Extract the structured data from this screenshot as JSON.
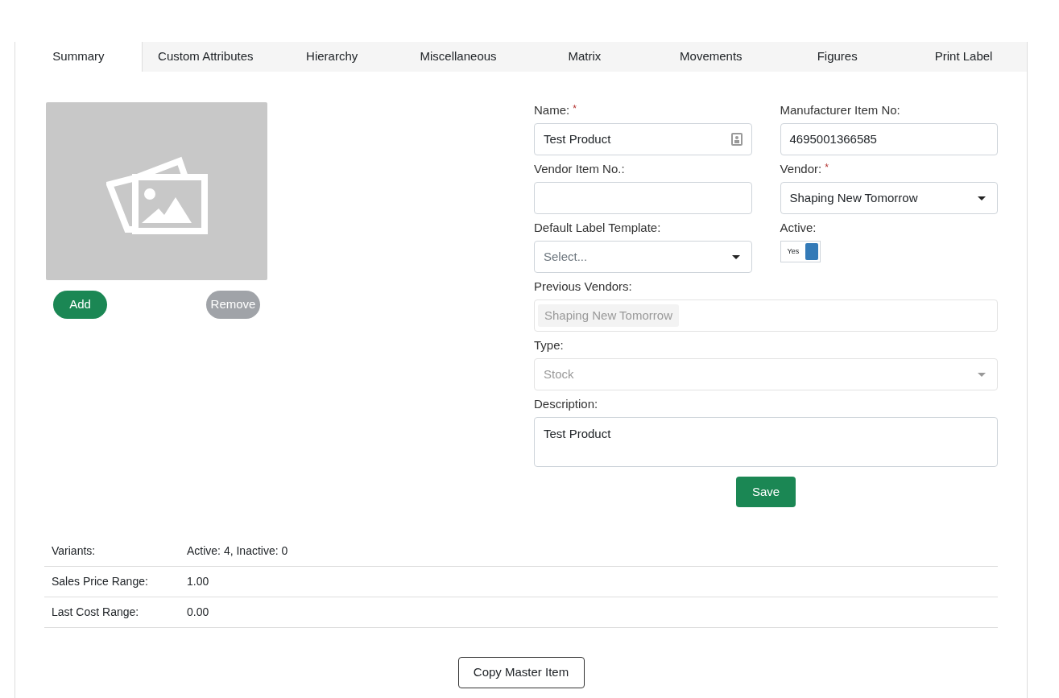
{
  "tabs": [
    {
      "label": "Summary",
      "selected": true
    },
    {
      "label": "Custom Attributes",
      "selected": false
    },
    {
      "label": "Hierarchy",
      "selected": false
    },
    {
      "label": "Miscellaneous",
      "selected": false
    },
    {
      "label": "Matrix",
      "selected": false
    },
    {
      "label": "Movements",
      "selected": false
    },
    {
      "label": "Figures",
      "selected": false
    },
    {
      "label": "Print Label",
      "selected": false
    }
  ],
  "image": {
    "add_button": "Add",
    "remove_button": "Remove",
    "remove_disabled": true
  },
  "form": {
    "rows": [
      [
        {
          "kind": "text",
          "label": "Name:",
          "required_mark": "*",
          "value": "Test Product",
          "icon": true
        },
        {
          "kind": "text",
          "label": "Manufacturer Item No:",
          "value": "4695001366585"
        }
      ],
      [
        {
          "kind": "text",
          "label": "Vendor Item No.:"
        },
        {
          "kind": "select",
          "label": "Vendor:",
          "required_mark": "*",
          "value": "Shaping New Tomorrow"
        }
      ],
      [
        {
          "kind": "select",
          "label": "Default Label Template:",
          "placeholder": "Select..."
        },
        {
          "kind": "toggle",
          "label": "Active:",
          "on": true,
          "text": "Yes"
        }
      ],
      [
        {
          "kind": "tags",
          "label": "Previous Vendors:",
          "tags": [
            "Shaping New Tomorrow"
          ],
          "disabled": true
        }
      ],
      [
        {
          "kind": "select",
          "label": "Type:",
          "value": "Stock",
          "disabled": true
        }
      ],
      [
        {
          "kind": "textarea",
          "label": "Description:",
          "value": "Test Product"
        }
      ]
    ],
    "save_button": "Save"
  },
  "summary": [
    {
      "label": "Variants:",
      "value": "Active: 4, Inactive: 0"
    },
    {
      "label": "Sales Price Range:",
      "value": "1.00"
    },
    {
      "label": "Last Cost Range:",
      "value": "0.00"
    }
  ],
  "copy_button": "Copy Master Item"
}
